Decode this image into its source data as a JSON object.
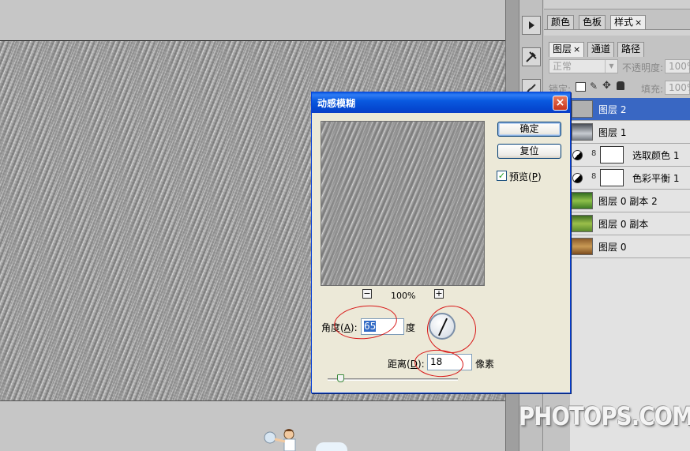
{
  "colors": {
    "dialog_titlebar": "#0a5ae0",
    "selected_layer": "#3967c3",
    "annotation": "#d81818"
  },
  "panel_top": {
    "tabs": [
      {
        "label": "颜色"
      },
      {
        "label": "色板"
      },
      {
        "label": "样式",
        "close": "×"
      }
    ]
  },
  "layers_panel": {
    "tabs": [
      {
        "label": "图层",
        "close": "×"
      },
      {
        "label": "通道"
      },
      {
        "label": "路径"
      }
    ],
    "blend_mode": "正常",
    "opacity_label": "不透明度:",
    "opacity_value": "100%",
    "lock_label": "锁定:",
    "fill_label": "填充:",
    "fill_value": "100%",
    "layers": [
      {
        "name": "图层 2",
        "selected": true
      },
      {
        "name": "图层 1"
      },
      {
        "name": "选取颜色 1",
        "adjustment": true
      },
      {
        "name": "色彩平衡 1",
        "adjustment": true
      },
      {
        "name": "图层 0 副本 2"
      },
      {
        "name": "图层 0 副本"
      },
      {
        "name": "图层 0"
      }
    ]
  },
  "dialog": {
    "title": "动感模糊",
    "close_glyph": "×",
    "ok_label": "确定",
    "reset_label": "复位",
    "preview_check": "✓",
    "preview_label_pre": "预览(",
    "preview_key": "P",
    "preview_label_post": ")",
    "zoom_out": "−",
    "zoom_in": "+",
    "zoom_value": "100%",
    "angle_label_pre": "角度(",
    "angle_key": "A",
    "angle_label_post": "):",
    "angle_value": "65",
    "angle_unit": "度",
    "distance_label_pre": "距离(",
    "distance_key": "D",
    "distance_label_post": "):",
    "distance_value": "18",
    "distance_unit": "像素",
    "distance_slider_fraction": 0.07
  },
  "watermark": "PHOTOPS.COM"
}
